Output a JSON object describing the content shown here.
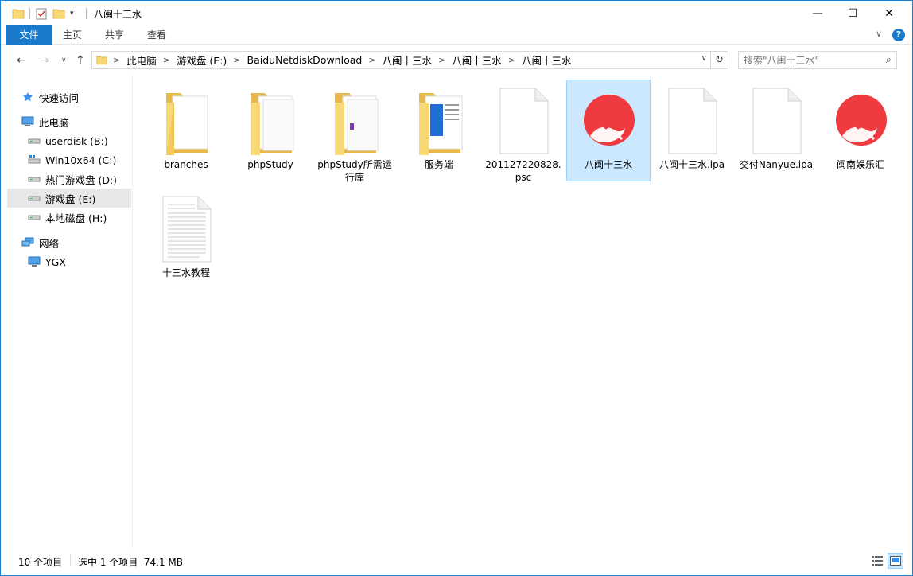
{
  "window": {
    "title": "八闽十三水",
    "minimize_glyph": "—",
    "maximize_glyph": "☐",
    "close_glyph": "✕"
  },
  "ribbon": {
    "tabs": [
      "文件",
      "主页",
      "共享",
      "查看"
    ],
    "help_glyph": "?",
    "expand_glyph": "∨"
  },
  "address": {
    "crumbs": [
      "此电脑",
      "游戏盘 (E:)",
      "BaiduNetdiskDownload",
      "八闽十三水",
      "八闽十三水",
      "八闽十三水"
    ],
    "separator": ">"
  },
  "search": {
    "placeholder": "搜索\"八闽十三水\""
  },
  "sidebar": {
    "items": [
      {
        "label": "快速访问",
        "icon": "star-icon"
      },
      {
        "label": "此电脑",
        "icon": "computer-icon"
      },
      {
        "label": "userdisk (B:)",
        "icon": "drive-icon"
      },
      {
        "label": "Win10x64 (C:)",
        "icon": "windows-drive-icon"
      },
      {
        "label": "热门游戏盘 (D:)",
        "icon": "drive-icon"
      },
      {
        "label": "游戏盘 (E:)",
        "icon": "drive-icon"
      },
      {
        "label": "本地磁盘 (H:)",
        "icon": "drive-icon"
      },
      {
        "label": "网络",
        "icon": "network-icon"
      },
      {
        "label": "YGX",
        "icon": "monitor-icon"
      }
    ]
  },
  "files": [
    {
      "name": "branches",
      "type": "folder"
    },
    {
      "name": "phpStudy",
      "type": "folder"
    },
    {
      "name": "phpStudy所需运行库",
      "type": "folder"
    },
    {
      "name": "服务端",
      "type": "folder"
    },
    {
      "name": "201127220828.psc",
      "type": "blank-file"
    },
    {
      "name": "八闽十三水",
      "type": "app",
      "selected": true
    },
    {
      "name": "八闽十三水.ipa",
      "type": "blank-file"
    },
    {
      "name": "交付Nanyue.ipa",
      "type": "blank-file"
    },
    {
      "name": "闽南娱乐汇",
      "type": "app"
    },
    {
      "name": "十三水教程",
      "type": "text-file"
    }
  ],
  "status": {
    "count": "10 个项目",
    "selection": "选中 1 个项目  74.1 MB"
  },
  "colors": {
    "accent": "#1979ca",
    "folder": "#f8d775",
    "app_red": "#ef3b3f",
    "selection": "#cce8ff"
  }
}
